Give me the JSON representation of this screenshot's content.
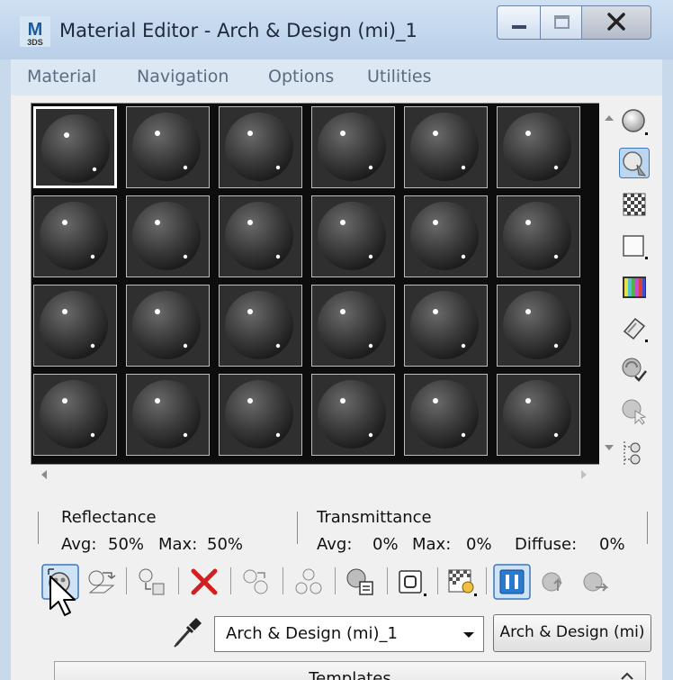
{
  "window": {
    "title": "Material Editor - Arch & Design (mi)_1"
  },
  "app_icon": {
    "big": "M",
    "small": "3DS"
  },
  "menu": [
    "Material",
    "Navigation",
    "Options",
    "Utilities"
  ],
  "sample_slots": {
    "rows": 4,
    "cols": 6,
    "selected_index": 0
  },
  "side_tools": [
    "sample-sphere-icon",
    "backlight-icon",
    "checker-background-icon",
    "sample-uv-tiling-icon",
    "video-color-check-icon",
    "make-preview-icon",
    "options-icon",
    "select-by-material-icon",
    "material-map-navigator-icon"
  ],
  "reflectance": {
    "label": "Reflectance",
    "avg_label": "Avg:",
    "avg": "50%",
    "max_label": "Max:",
    "max": "50%"
  },
  "transmittance": {
    "label": "Transmittance",
    "avg_label": "Avg:",
    "avg": "0%",
    "max_label": "Max:",
    "max": "0%",
    "diffuse_label": "Diffuse:",
    "diffuse": "0%"
  },
  "toolbar": [
    "get-material-icon",
    "put-to-scene-icon",
    "assign-to-selection-icon",
    "reset-map-icon",
    "copy-material-icon",
    "make-unique-icon",
    "put-to-library-icon",
    "material-id-channel-icon",
    "show-map-in-viewport-icon",
    "show-end-result-icon",
    "go-to-parent-icon",
    "go-forward-to-sibling-icon"
  ],
  "material_name": "Arch & Design (mi)_1",
  "material_type": "Arch & Design (mi)",
  "rollout": {
    "title": "Templates"
  },
  "colors": {
    "accent": "#c9d9ec",
    "delete": "#d22020",
    "sample_bg": "#2f2f2f"
  }
}
